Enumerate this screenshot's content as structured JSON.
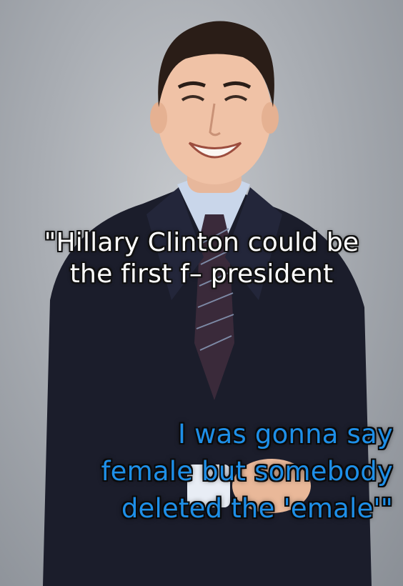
{
  "caption_top": {
    "line1": "\"Hillary Clinton could be",
    "line2": "the first f– president"
  },
  "caption_bottom": {
    "line1": "I was gonna say",
    "line2": "female but somebody",
    "line3": "deleted the 'emale'\""
  },
  "colors": {
    "background": "#a9adb3",
    "suit": "#1b1d2b",
    "shirt": "#c9d6ea",
    "tie": "#3a2a3a",
    "caption_top_text": "#ffffff",
    "caption_bottom_text": "#1e8fe8"
  }
}
